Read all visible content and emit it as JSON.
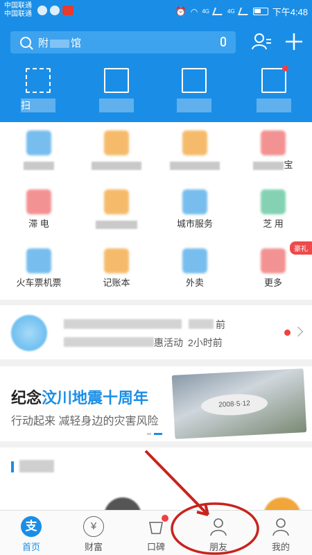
{
  "status_bar": {
    "carrier_1": "中国联通",
    "carrier_2": "中国联通",
    "net_1": "4G",
    "net_2": "4G",
    "time": "下午4:48"
  },
  "search": {
    "text_prefix": "附",
    "text_suffix": "馆"
  },
  "quick_actions": [
    {
      "icon": "scan-icon",
      "label": "扫"
    },
    {
      "icon": "barcode-icon",
      "label": ""
    },
    {
      "icon": "yuan-card-icon",
      "label": ""
    },
    {
      "icon": "wallet-icon",
      "label": ""
    }
  ],
  "grid": [
    {
      "label": "",
      "icon_color": "#4aa8e8"
    },
    {
      "label": "",
      "icon_color": "#f2a53a"
    },
    {
      "label": "",
      "icon_color": "#f2a53a"
    },
    {
      "label": "宝",
      "icon_color": "#f06e6e"
    },
    {
      "label": "滞 电",
      "icon_color": "#f06e6e"
    },
    {
      "label": "",
      "icon_color": "#f2a53a"
    },
    {
      "label": "城市服务",
      "icon_color": "#4aa8e8"
    },
    {
      "label": "芝 用",
      "icon_color": "#5bc49a"
    },
    {
      "label": "火车票机票",
      "icon_color": "#4aa8e8"
    },
    {
      "label": "记账本",
      "icon_color": "#f2a53a"
    },
    {
      "label": "外卖",
      "icon_color": "#4aa8e8"
    },
    {
      "label": "更多",
      "icon_color": "#f06e6e"
    }
  ],
  "grid_badge": "豪礼",
  "notice": {
    "line_1_time": "前",
    "line_2_text": "惠活动",
    "line_2_time": "2小时前"
  },
  "banner": {
    "title_part_1": "纪念",
    "title_highlight": "汶川地震十周年",
    "subtitle": "行动起来 减轻身边的灾害风险",
    "photo_date": "2008·5·12"
  },
  "tabs": [
    {
      "label": "首页",
      "glyph": "支",
      "active": true
    },
    {
      "label": "财富",
      "glyph": "¥",
      "active": false
    },
    {
      "label": "口碑",
      "glyph": "",
      "active": false
    },
    {
      "label": "朋友",
      "glyph": "",
      "active": false
    },
    {
      "label": "我的",
      "glyph": "",
      "active": false
    }
  ],
  "colors": {
    "brand_blue": "#1a8ee6",
    "badge_red": "#f23f3f",
    "annotation_red": "#c8231d"
  }
}
